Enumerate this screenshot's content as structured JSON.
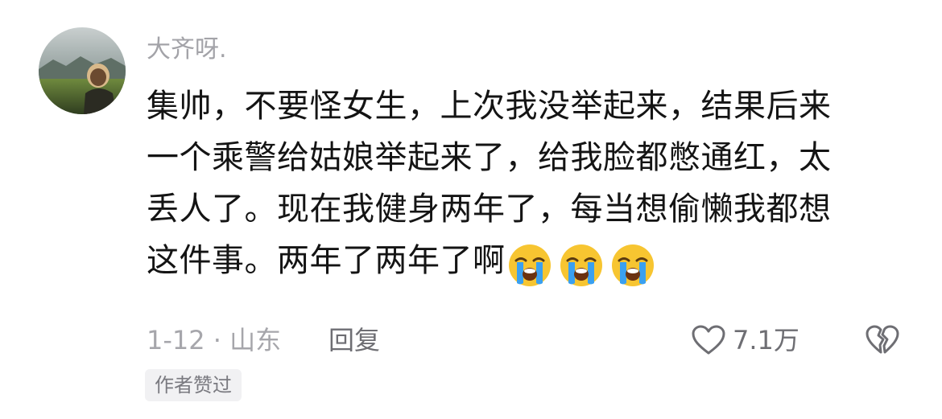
{
  "comment": {
    "username": "大齐呀.",
    "content_lines": [
      "集帅，不要怪女生，上次我没举起来，结果后来",
      "一个乘警给姑娘举起来了，给我脸都憋通红，太",
      "丢人了。现在我健身两年了，每当想偷懒我都想",
      "这件事。两年了两年了啊"
    ],
    "emojis": [
      "loudly-crying-face",
      "loudly-crying-face",
      "loudly-crying-face"
    ],
    "date_location": "1-12 · 山东",
    "reply_label": "回复",
    "like_count": "7.1万",
    "author_badge": "作者赞过"
  },
  "colors": {
    "username": "#a3a3a8",
    "content": "#141414",
    "meta": "#a6a6ab",
    "badge_bg": "#f1f1f3",
    "emoji_face": "#f7c531",
    "emoji_tears": "#3aa0f0"
  }
}
